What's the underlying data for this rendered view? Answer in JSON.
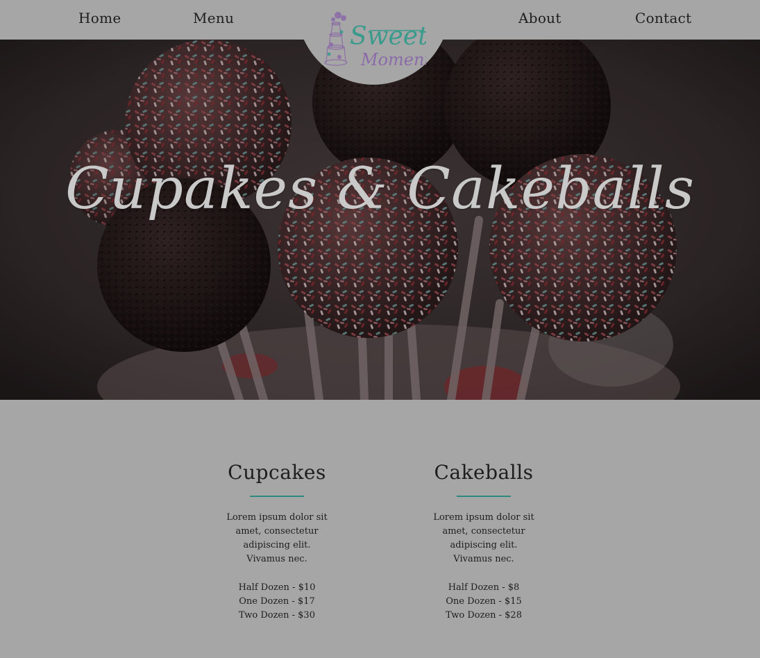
{
  "nav": {
    "home": "Home",
    "menu": "Menu",
    "about": "About",
    "contact": "Contact"
  },
  "logo": {
    "line1": "Sweet",
    "line2": "Moments",
    "primary_color": "#3a9a8c",
    "secondary_color": "#8b6aa8"
  },
  "hero": {
    "title": "Cupakes & Cakeballs"
  },
  "sections": [
    {
      "heading": "Cupcakes",
      "description": "Lorem ipsum dolor sit amet, consectetur adipiscing elit. Vivamus nec.",
      "prices": [
        "Half Dozen - $10",
        "One Dozen - $17",
        "Two Dozen - $30"
      ]
    },
    {
      "heading": "Cakeballs",
      "description": "Lorem ipsum dolor sit amet, consectetur adipiscing elit. Vivamus nec.",
      "prices": [
        "Half Dozen - $8",
        "One Dozen - $15",
        "Two Dozen - $28"
      ]
    }
  ],
  "colors": {
    "background": "#a6a6a6",
    "accent_rule": "#2a8a80",
    "text": "#1d1d1d",
    "hero_title": "#c9c9c9"
  }
}
